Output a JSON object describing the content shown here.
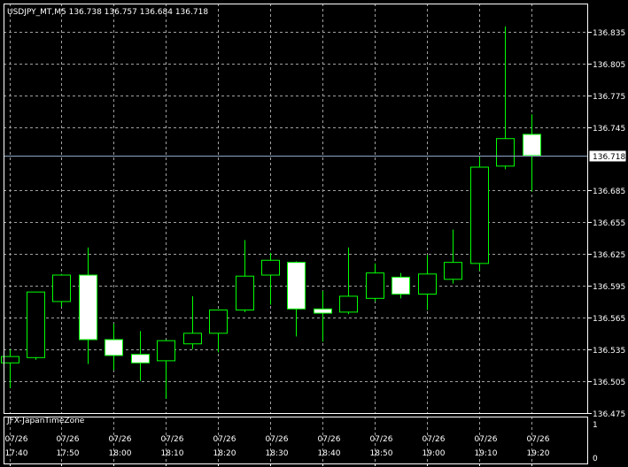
{
  "window": {
    "header": "USDJPY_MT,M5  136.738 136.757 136.684 136.718"
  },
  "indicator": {
    "name": "JFX-JapanTimeZone",
    "scale_top": "1",
    "scale_bottom": "0"
  },
  "colors": {
    "background": "#000000",
    "frame": "#ffffff",
    "grid": "#a0a0a0",
    "candle_outline": "#00ff00",
    "wick": "#00ff00",
    "bull_fill": "#000000",
    "bear_fill": "#ffffff",
    "price_line": "#8fa6c8"
  },
  "chart_data": {
    "type": "candlestick",
    "symbol": "USDJPY_MT",
    "timeframe": "M5",
    "ohlc_header": {
      "open": 136.738,
      "high": 136.757,
      "low": 136.684,
      "close": 136.718
    },
    "current_price": 136.718,
    "ylim": [
      136.46,
      136.85
    ],
    "y_ticks": [
      136.835,
      136.805,
      136.775,
      136.745,
      136.685,
      136.655,
      136.625,
      136.595,
      136.565,
      136.535,
      136.505,
      136.475
    ],
    "y_ticks_text": [
      "136.835",
      "136.805",
      "136.775",
      "136.745",
      "136.685",
      "136.655",
      "136.625",
      "136.595",
      "136.565",
      "136.535",
      "136.505",
      "136.475"
    ],
    "current_price_label": "136.718",
    "x_labels": [
      {
        "date": "07/26",
        "time": "17:40"
      },
      {
        "date": "07/26",
        "time": "17:50"
      },
      {
        "date": "07/26",
        "time": "18:00"
      },
      {
        "date": "07/26",
        "time": "18:10"
      },
      {
        "date": "07/26",
        "time": "18:20"
      },
      {
        "date": "07/26",
        "time": "18:30"
      },
      {
        "date": "07/26",
        "time": "18:40"
      },
      {
        "date": "07/26",
        "time": "18:50"
      },
      {
        "date": "07/26",
        "time": "19:00"
      },
      {
        "date": "07/26",
        "time": "19:10"
      },
      {
        "date": "07/26",
        "time": "19:20"
      }
    ],
    "candles": [
      {
        "time": "17:40",
        "open": 136.522,
        "high": 136.535,
        "low": 136.498,
        "close": 136.528
      },
      {
        "time": "17:45",
        "open": 136.527,
        "high": 136.589,
        "low": 136.525,
        "close": 136.589
      },
      {
        "time": "17:50",
        "open": 136.58,
        "high": 136.606,
        "low": 136.575,
        "close": 136.605
      },
      {
        "time": "17:55",
        "open": 136.605,
        "high": 136.631,
        "low": 136.521,
        "close": 136.544
      },
      {
        "time": "18:00",
        "open": 136.544,
        "high": 136.559,
        "low": 136.515,
        "close": 136.529
      },
      {
        "time": "18:05",
        "open": 136.53,
        "high": 136.552,
        "low": 136.505,
        "close": 136.522
      },
      {
        "time": "18:10",
        "open": 136.524,
        "high": 136.544,
        "low": 136.488,
        "close": 136.543
      },
      {
        "time": "18:15",
        "open": 136.54,
        "high": 136.585,
        "low": 136.535,
        "close": 136.55
      },
      {
        "time": "18:20",
        "open": 136.55,
        "high": 136.57,
        "low": 136.532,
        "close": 136.572
      },
      {
        "time": "18:25",
        "open": 136.572,
        "high": 136.638,
        "low": 136.57,
        "close": 136.604
      },
      {
        "time": "18:30",
        "open": 136.605,
        "high": 136.626,
        "low": 136.577,
        "close": 136.619
      },
      {
        "time": "18:35",
        "open": 136.617,
        "high": 136.618,
        "low": 136.547,
        "close": 136.573
      },
      {
        "time": "18:40",
        "open": 136.573,
        "high": 136.59,
        "low": 136.542,
        "close": 136.569
      },
      {
        "time": "18:45",
        "open": 136.57,
        "high": 136.631,
        "low": 136.568,
        "close": 136.585
      },
      {
        "time": "18:50",
        "open": 136.583,
        "high": 136.616,
        "low": 136.58,
        "close": 136.607
      },
      {
        "time": "18:55",
        "open": 136.603,
        "high": 136.607,
        "low": 136.583,
        "close": 136.587
      },
      {
        "time": "19:00",
        "open": 136.587,
        "high": 136.624,
        "low": 136.572,
        "close": 136.606
      },
      {
        "time": "19:05",
        "open": 136.601,
        "high": 136.648,
        "low": 136.597,
        "close": 136.617
      },
      {
        "time": "19:10",
        "open": 136.616,
        "high": 136.717,
        "low": 136.609,
        "close": 136.707
      },
      {
        "time": "19:15",
        "open": 136.708,
        "high": 136.84,
        "low": 136.705,
        "close": 136.734
      },
      {
        "time": "19:20",
        "open": 136.738,
        "high": 136.757,
        "low": 136.684,
        "close": 136.718
      }
    ]
  }
}
